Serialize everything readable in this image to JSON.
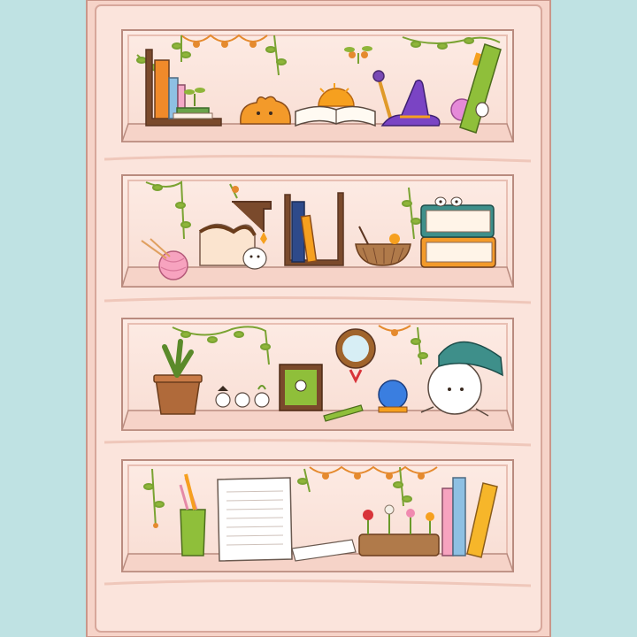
{
  "scene": {
    "background_color": "#bfe2e3",
    "cabinet_color": "#fbe6dd",
    "frame_color": "#f5d1c5",
    "outline_color": "#a07b6e",
    "vine_color": "#8fb53a",
    "garland_color": "#e58a2e"
  },
  "shelves": [
    {
      "name": "shelf-1",
      "items": [
        "bookend-books",
        "seedling",
        "orange-cat-loaf",
        "open-book-sun",
        "magic-wand",
        "witch-hat",
        "crystal-orb",
        "green-book",
        "peeking-spirit"
      ]
    },
    {
      "name": "shelf-2",
      "items": [
        "yarn-ball",
        "bread-loaf",
        "hanging-charm",
        "small-spirit",
        "bookend-blue-books",
        "basket-bowl",
        "stacked-books",
        "peeking-eyes"
      ]
    },
    {
      "name": "shelf-3",
      "items": [
        "potted-plant",
        "three-spirits",
        "framed-picture",
        "pencil",
        "round-mirror",
        "crystal-ball",
        "big-spirit-cap"
      ]
    },
    {
      "name": "shelf-4",
      "items": [
        "pencil-cup",
        "paper-stack",
        "receipt",
        "flower-planter",
        "standing-books"
      ]
    }
  ]
}
